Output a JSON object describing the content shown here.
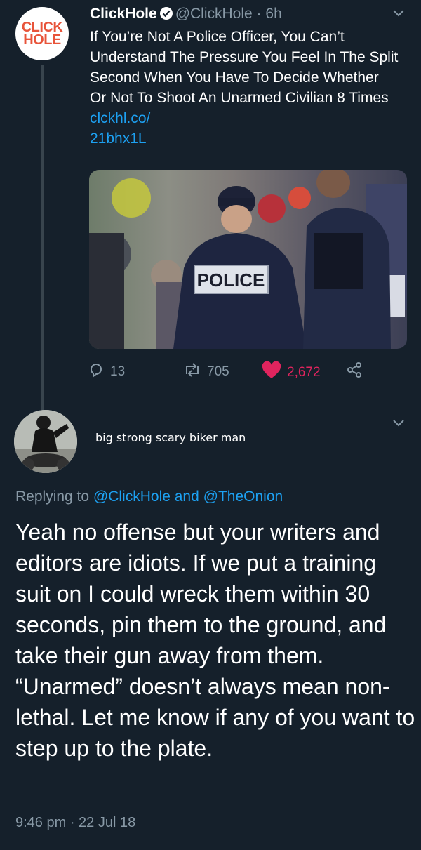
{
  "tweet": {
    "avatar_text_1": "CLICK",
    "avatar_text_2": "HOLE",
    "display_name": "ClickHole",
    "handle": "@ClickHole",
    "separator": " · ",
    "time": "6h",
    "text": "If You’re Not A Police Officer, You Can’t Understand The Pressure You Feel In The Split Second When You Have To Decide Whether Or Not To Shoot An Unarmed Civilian 8 Times ",
    "link": "clckhl.co/\n21bhx1L",
    "media_label": "POLICE",
    "replies": "13",
    "retweets": "705",
    "likes": "2,672"
  },
  "reply": {
    "display_name": "big strong scary biker man",
    "replying_prefix": "Replying to ",
    "mention_1": "@ClickHole",
    "replying_and": " and ",
    "mention_2": "@TheOnion",
    "text": "Yeah no offense but your writers and editors are idiots. If we put a training suit on I could wreck them within 30 seconds, pin them to the ground, and take their gun away from them. “Unarmed” doesn’t always mean non-lethal. Let me know if any of you want to step up to the plate.",
    "timestamp": "9:46 pm · 22 Jul 18"
  },
  "icons": [
    "verified-icon",
    "chevron-down-icon",
    "reply-icon",
    "retweet-icon",
    "heart-icon",
    "share-icon"
  ],
  "colors": {
    "background": "#15202b",
    "muted": "#8899a6",
    "link": "#1da1f2",
    "like": "#e0245e",
    "brand": "#e8543a"
  }
}
